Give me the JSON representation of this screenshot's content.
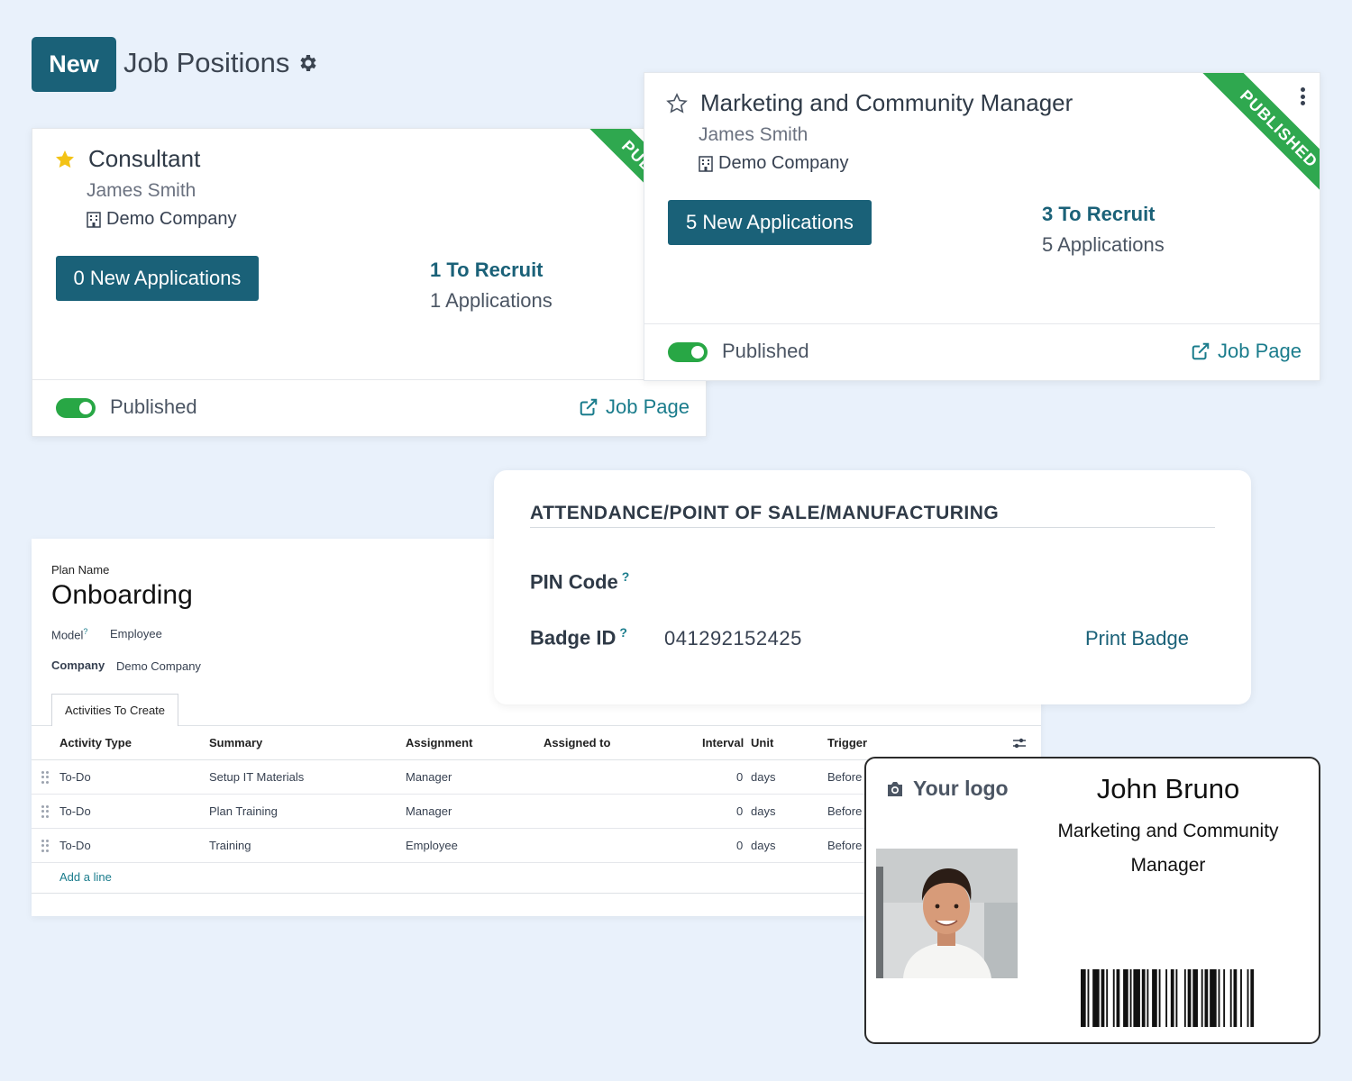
{
  "header": {
    "new_label": "New",
    "title": "Job Positions"
  },
  "jobs": [
    {
      "title": "Consultant",
      "favorite": true,
      "recruiter": "James Smith",
      "company": "Demo Company",
      "new_applications": "0 New Applications",
      "to_recruit": "1 To Recruit",
      "applications": "1 Applications",
      "ribbon": "PUBLISHED",
      "status": "Published",
      "job_page": "Job Page"
    },
    {
      "title": "Marketing and Community Manager",
      "favorite": false,
      "recruiter": "James Smith",
      "company": "Demo Company",
      "new_applications": "5 New Applications",
      "to_recruit": "3 To Recruit",
      "applications": "5 Applications",
      "ribbon": "PUBLISHED",
      "status": "Published",
      "job_page": "Job Page"
    }
  ],
  "plan": {
    "name_label": "Plan Name",
    "name": "Onboarding",
    "model_label": "Model",
    "model_value": "Employee",
    "company_label": "Company",
    "company_value": "Demo Company",
    "tab": "Activities To Create",
    "columns": [
      "Activity Type",
      "Summary",
      "Assignment",
      "Assigned to",
      "Interval",
      "Unit",
      "Trigger"
    ],
    "rows": [
      {
        "type": "To-Do",
        "summary": "Setup IT Materials",
        "assignment": "Manager",
        "assigned_to": "",
        "interval": "0",
        "unit": "days",
        "trigger": "Before"
      },
      {
        "type": "To-Do",
        "summary": "Plan Training",
        "assignment": "Manager",
        "assigned_to": "",
        "interval": "0",
        "unit": "days",
        "trigger": "Before"
      },
      {
        "type": "To-Do",
        "summary": "Training",
        "assignment": "Employee",
        "assigned_to": "",
        "interval": "0",
        "unit": "days",
        "trigger": "Before"
      }
    ],
    "add_line": "Add a line"
  },
  "attendance": {
    "heading": "ATTENDANCE/POINT OF SALE/MANUFACTURING",
    "pin_label": "PIN Code",
    "badge_label": "Badge ID",
    "help_mark": "?",
    "badge_value": "041292152425",
    "print_badge": "Print Badge"
  },
  "badge": {
    "logo_text": "Your logo",
    "name": "John Bruno",
    "role": "Marketing and Community Manager"
  },
  "colors": {
    "primary": "#1a6178",
    "success": "#28a745",
    "link": "#1a7c8c",
    "background": "#e9f1fb"
  }
}
